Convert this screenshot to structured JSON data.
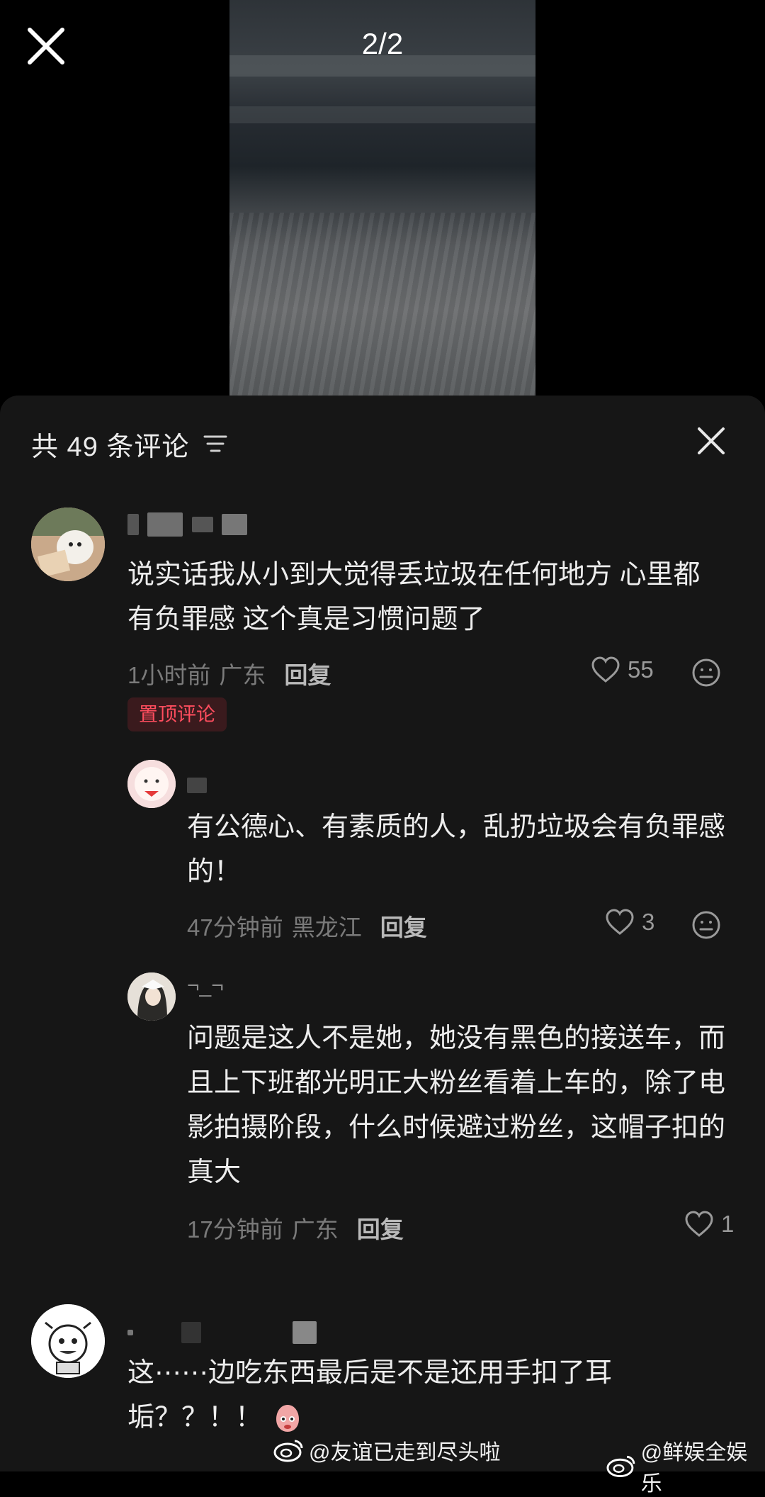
{
  "viewer": {
    "counter": "2/2"
  },
  "panel": {
    "title": "共 49 条评论"
  },
  "comments": [
    {
      "text": "说实话我从小到大觉得丢垃圾在任何地方 心里都有负罪感 这个真是习惯问题了",
      "time": "1小时前",
      "location": "广东",
      "reply_label": "回复",
      "likes": "55",
      "badge": "置顶评论"
    },
    {
      "text": "有公德心、有素质的人，乱扔垃圾会有负罪感的！",
      "time": "47分钟前",
      "location": "黑龙江",
      "reply_label": "回复",
      "likes": "3"
    },
    {
      "username": "¬_¬",
      "text": "问题是这人不是她，她没有黑色的接送车，而且上下班都光明正大粉丝看着上车的，除了电影拍摄阶段，什么时候避过粉丝，这帽子扣的真大",
      "time": "17分钟前",
      "location": "广东",
      "reply_label": "回复",
      "likes": "1"
    },
    {
      "text": "这⋯⋯边吃东西最后是不是还用手扣了耳垢？？！！"
    }
  ],
  "watermarks": {
    "left": "@友谊已走到尽头啦",
    "right": "@鲜娱全娱乐"
  },
  "colors": {
    "panel_bg": "#161616",
    "badge_text": "#ff4d5e",
    "badge_bg": "#3a1a1d"
  }
}
